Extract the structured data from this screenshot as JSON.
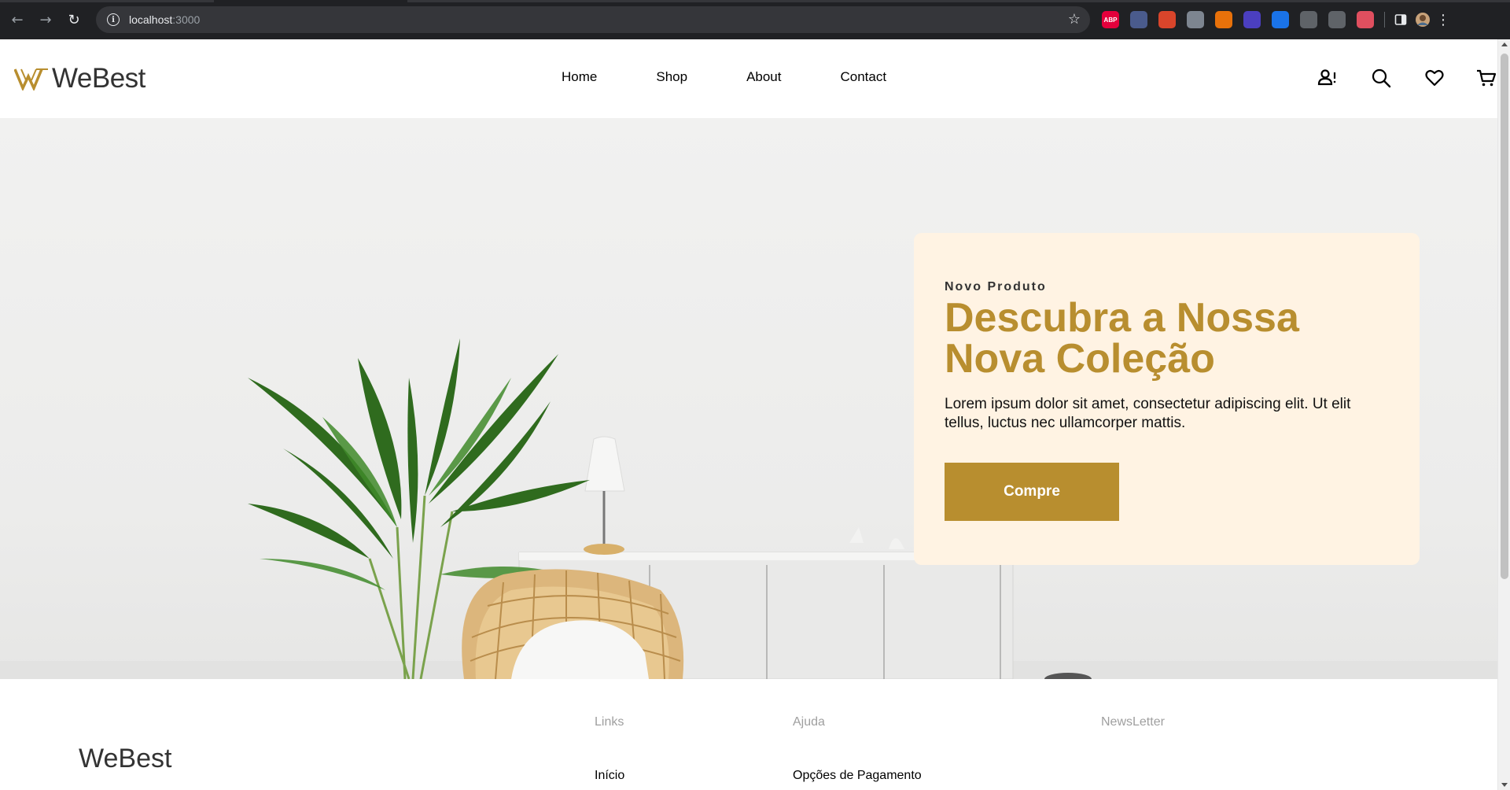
{
  "browser": {
    "url_host": "localhost",
    "url_port": ":3000",
    "extensions": [
      {
        "name": "adblock-plus-icon",
        "label": "ABP",
        "color": "#e4003c"
      },
      {
        "name": "cursor-ext-icon",
        "label": "",
        "color": "#4a5b8c"
      },
      {
        "name": "red-ext-icon",
        "label": "",
        "color": "#d9452b"
      },
      {
        "name": "vue-devtools-icon",
        "label": "",
        "color": "#7d8590"
      },
      {
        "name": "fox-ext-icon",
        "label": "",
        "color": "#e8710a"
      },
      {
        "name": "eye-ext-icon",
        "label": "",
        "color": "#4b3fbf"
      },
      {
        "name": "check-ext-icon",
        "label": "",
        "color": "#1a73e8"
      },
      {
        "name": "face-ext-icon",
        "label": "",
        "color": "#5f6368"
      },
      {
        "name": "eyedropper-ext-icon",
        "label": "",
        "color": "#5f6368"
      },
      {
        "name": "shield-ext-icon",
        "label": "",
        "color": "#e04f5f"
      }
    ]
  },
  "site": {
    "brand": "WeBest",
    "nav": [
      "Home",
      "Shop",
      "About",
      "Contact"
    ],
    "colors": {
      "accent": "#b88e2f",
      "card_bg": "#fff3e3"
    }
  },
  "hero": {
    "eyebrow": "Novo Produto",
    "title_line1": "Descubra a Nossa",
    "title_line2": "Nova Coleção",
    "body": "Lorem ipsum dolor sit amet, consectetur adipiscing elit. Ut elit tellus, luctus nec ullamcorper mattis.",
    "cta": "Compre"
  },
  "footer": {
    "brand": "WeBest",
    "links_heading": "Links",
    "links_first": "Início",
    "help_heading": "Ajuda",
    "help_first": "Opções de Pagamento",
    "newsletter_heading": "NewsLetter"
  }
}
